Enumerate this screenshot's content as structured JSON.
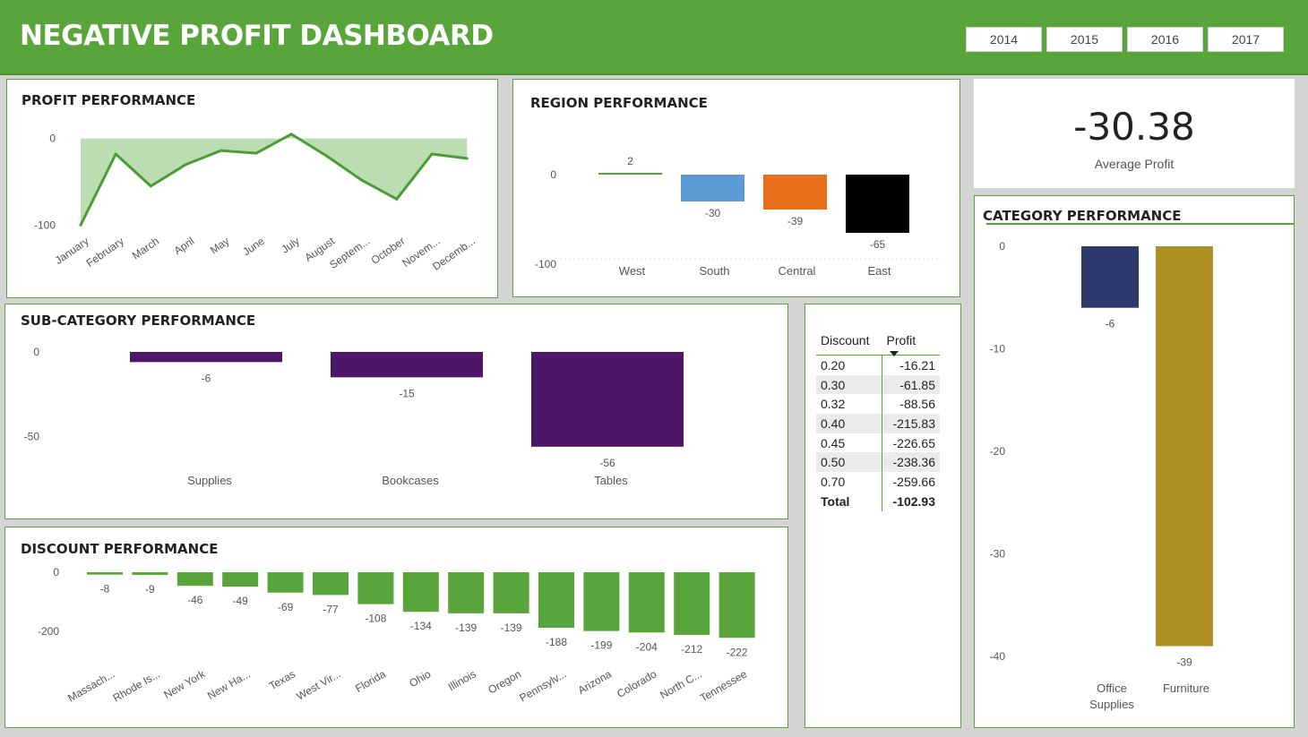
{
  "header": {
    "title": "NEGATIVE PROFIT DASHBOARD",
    "years": [
      "2014",
      "2015",
      "2016",
      "2017"
    ]
  },
  "kpi": {
    "value": "-30.38",
    "label": "Average Profit"
  },
  "panels": {
    "profit": "PROFIT PERFORMANCE",
    "region": "REGION PERFORMANCE",
    "category": "CATEGORY PERFORMANCE",
    "subcategory": "SUB-CATEGORY PERFORMANCE",
    "discount": "DISCOUNT PERFORMANCE"
  },
  "chart_data": [
    {
      "id": "profit",
      "type": "area",
      "title": "PROFIT PERFORMANCE",
      "categories": [
        "January",
        "February",
        "March",
        "April",
        "May",
        "June",
        "July",
        "August",
        "Septem...",
        "October",
        "Novem...",
        "Decemb..."
      ],
      "values": [
        -100,
        -18,
        -55,
        -30,
        -14,
        -17,
        5,
        -20,
        -48,
        -70,
        -18,
        -23
      ],
      "yticks": [
        0,
        -100
      ],
      "ylim": [
        -112,
        12
      ],
      "colors": {
        "line": "#4c9c34",
        "fill": "#bcdcb2"
      }
    },
    {
      "id": "region",
      "type": "bar",
      "title": "REGION PERFORMANCE",
      "categories": [
        "West",
        "South",
        "Central",
        "East"
      ],
      "values": [
        2,
        -30,
        -39,
        -65
      ],
      "labels": [
        "2",
        "-30",
        "-39",
        "-65"
      ],
      "yticks": [
        0,
        -100
      ],
      "ylim": [
        -100,
        10
      ],
      "colors": [
        "#5aa43c",
        "#5b9bd5",
        "#e8701a",
        "#000000"
      ]
    },
    {
      "id": "category",
      "type": "bar",
      "title": "CATEGORY PERFORMANCE",
      "categories": [
        [
          "Office",
          "Supplies"
        ],
        [
          "Furniture"
        ]
      ],
      "values": [
        -6,
        -39
      ],
      "labels": [
        "-6",
        "-39"
      ],
      "yticks": [
        0,
        -10,
        -20,
        -30,
        -40
      ],
      "ylim": [
        -40,
        0
      ],
      "colors": [
        "#2e3a6e",
        "#ad8f22"
      ]
    },
    {
      "id": "subcategory",
      "type": "bar",
      "title": "SUB-CATEGORY PERFORMANCE",
      "categories": [
        "Supplies",
        "Bookcases",
        "Tables"
      ],
      "values": [
        -6,
        -15,
        -56
      ],
      "labels": [
        "-6",
        "-15",
        "-56"
      ],
      "yticks": [
        0,
        -50
      ],
      "ylim": [
        -50,
        0
      ],
      "colors": [
        "#4d1666"
      ]
    },
    {
      "id": "discount",
      "type": "bar",
      "title": "DISCOUNT PERFORMANCE",
      "categories": [
        "Massach...",
        "Rhode Is...",
        "New York",
        "New Ha...",
        "Texas",
        "West Vir...",
        "Florida",
        "Ohio",
        "Illinois",
        "Oregon",
        "Pennsylv...",
        "Arizona",
        "Colorado",
        "North C...",
        "Tennessee"
      ],
      "values": [
        -8,
        -9,
        -46,
        -49,
        -69,
        -77,
        -108,
        -134,
        -139,
        -139,
        -188,
        -199,
        -204,
        -212,
        -222
      ],
      "labels": [
        "-8",
        "-9",
        "-46",
        "-49",
        "-69",
        "-77",
        "-108",
        "-134",
        "-139",
        "-139",
        "-188",
        "-199",
        "-204",
        "-212",
        "-222"
      ],
      "yticks": [
        0,
        -200
      ],
      "ylim": [
        -200,
        0
      ],
      "colors": [
        "#5aa43c"
      ]
    },
    {
      "id": "discount_table",
      "type": "table",
      "columns": [
        "Discount",
        "Profit"
      ],
      "rows": [
        [
          "0.20",
          "-16.21"
        ],
        [
          "0.30",
          "-61.85"
        ],
        [
          "0.32",
          "-88.56"
        ],
        [
          "0.40",
          "-215.83"
        ],
        [
          "0.45",
          "-226.65"
        ],
        [
          "0.50",
          "-238.36"
        ],
        [
          "0.70",
          "-259.66"
        ]
      ],
      "total": [
        "Total",
        "-102.93"
      ]
    }
  ]
}
